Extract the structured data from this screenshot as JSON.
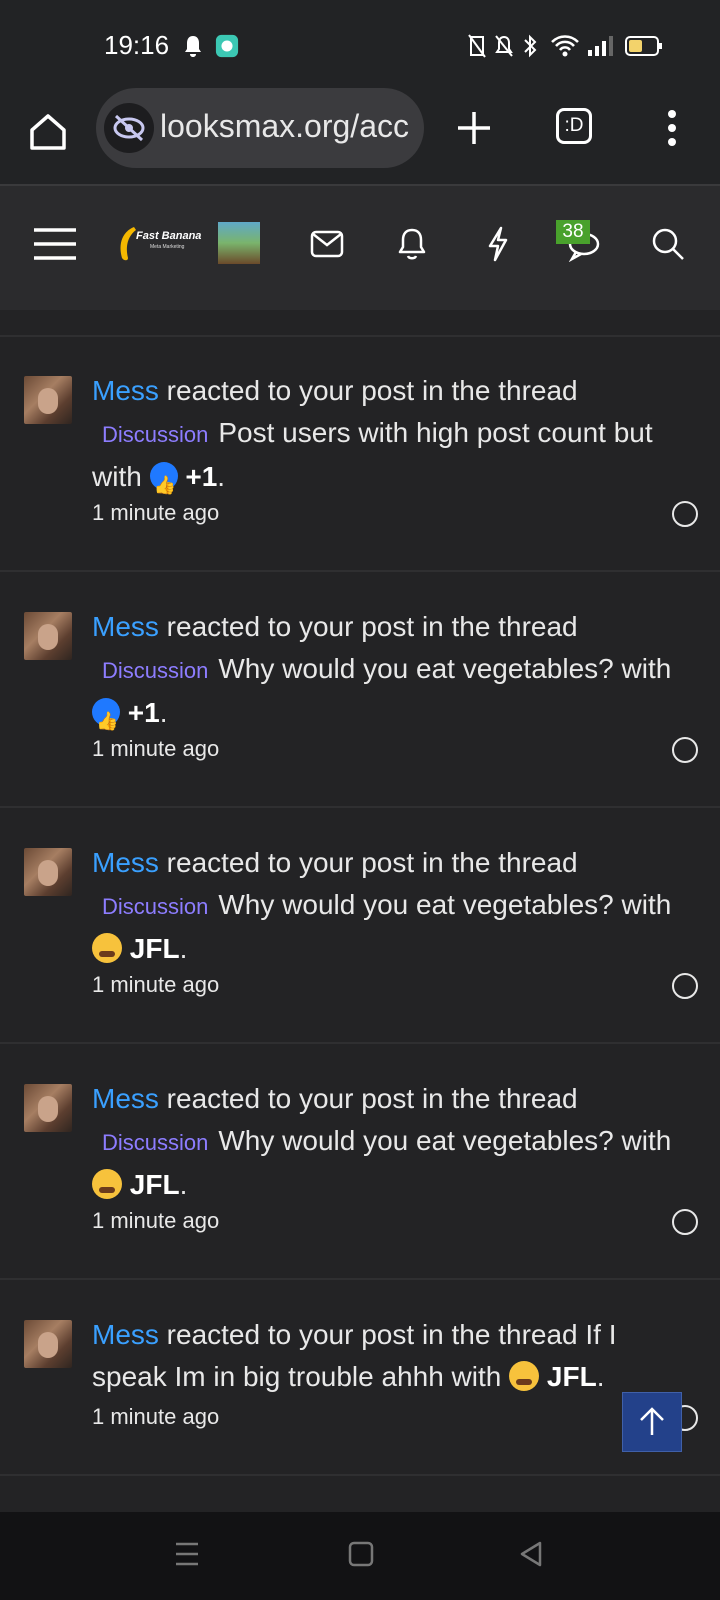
{
  "status": {
    "time": "19:16",
    "icons": [
      "notification-bell-icon",
      "app-icon",
      "nfc-off-icon",
      "mute-icon",
      "bluetooth-icon",
      "wifi-icon",
      "signal-icon",
      "battery-icon"
    ]
  },
  "browser": {
    "url": "looksmax.org/acc",
    "new_tab_icon": "plus-icon",
    "tabs_label": ":D",
    "menu_icon": "kebab-icon"
  },
  "site": {
    "logo_label": "Fast Banana",
    "logo_sub": "Meta Marketing",
    "badge_count": "38"
  },
  "notifications": [
    {
      "user": "Mess",
      "text_before": " reacted to your post in the thread ",
      "prefix": "Discussion",
      "thread": "Post users with high post count but",
      "with": " with ",
      "reaction": "+1",
      "reaction_type": "like",
      "end": ".",
      "time": "1 minute ago"
    },
    {
      "user": "Mess",
      "text_before": " reacted to your post in the thread ",
      "prefix": "Discussion",
      "thread": "Why would you eat vegetables?",
      "with": " with ",
      "reaction": "+1",
      "reaction_type": "like",
      "end": ".",
      "time": "1 minute ago"
    },
    {
      "user": "Mess",
      "text_before": " reacted to your post in the thread ",
      "prefix": "Discussion",
      "thread": "Why would you eat vegetables?",
      "with": " with ",
      "reaction": "JFL",
      "reaction_type": "cry",
      "end": ".",
      "time": "1 minute ago"
    },
    {
      "user": "Mess",
      "text_before": " reacted to your post in the thread ",
      "prefix": "Discussion",
      "thread": "Why would you eat vegetables?",
      "with": " with ",
      "reaction": "JFL",
      "reaction_type": "cry",
      "end": ".",
      "time": "1 minute ago"
    },
    {
      "user": "Mess",
      "text_before": " reacted to your post in the thread ",
      "prefix": "",
      "thread": "If I speak Im in big trouble ahhh",
      "with": " with ",
      "reaction": "JFL",
      "reaction_type": "cry",
      "end": ".",
      "time": "1 minute ago"
    }
  ],
  "colors": {
    "background": "#232325",
    "username": "#3aa0ff",
    "prefix": "#8d7dff",
    "badge": "#49a12c",
    "scroll_button": "#23418a"
  }
}
